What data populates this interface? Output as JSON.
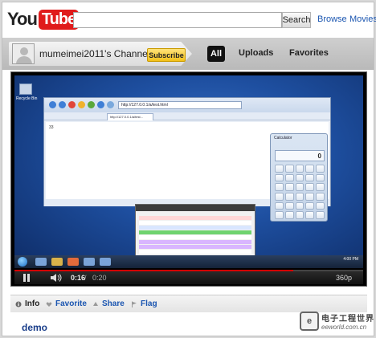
{
  "header": {
    "logo_you": "You",
    "logo_tube": "Tube",
    "search_placeholder": "",
    "search_button": "Search",
    "nav": [
      "Browse",
      "Movies"
    ]
  },
  "channel": {
    "name": "mumeimei2011's Channel",
    "subscribe_label": "Subscribe",
    "tabs": [
      "All",
      "Uploads",
      "Favorites"
    ]
  },
  "video": {
    "browser_url": "http://127.0.0.1/a/test.html",
    "browser_tab": "http://127.0.0.1/a/test...",
    "calculator_title": "Calculator",
    "calculator_display": "0",
    "desktop_icon_label": "Recycle Bin",
    "clock": "4:00 PM",
    "current_time": "0:16",
    "separator": "/",
    "total_time": "0:20",
    "progress": 0.8,
    "quality": "360p"
  },
  "info_bar": {
    "info": "Info",
    "favorite": "Favorite",
    "share": "Share",
    "flag": "Flag"
  },
  "description": {
    "title": "demo"
  },
  "watermark": {
    "cn": "电子工程世界",
    "url": "eeworld.com.cn"
  },
  "colors": {
    "youtube_red": "#e01b1b",
    "link_blue": "#1a55b0",
    "subscribe_yellow": "#f3c11a",
    "progress_red": "#d40000"
  }
}
